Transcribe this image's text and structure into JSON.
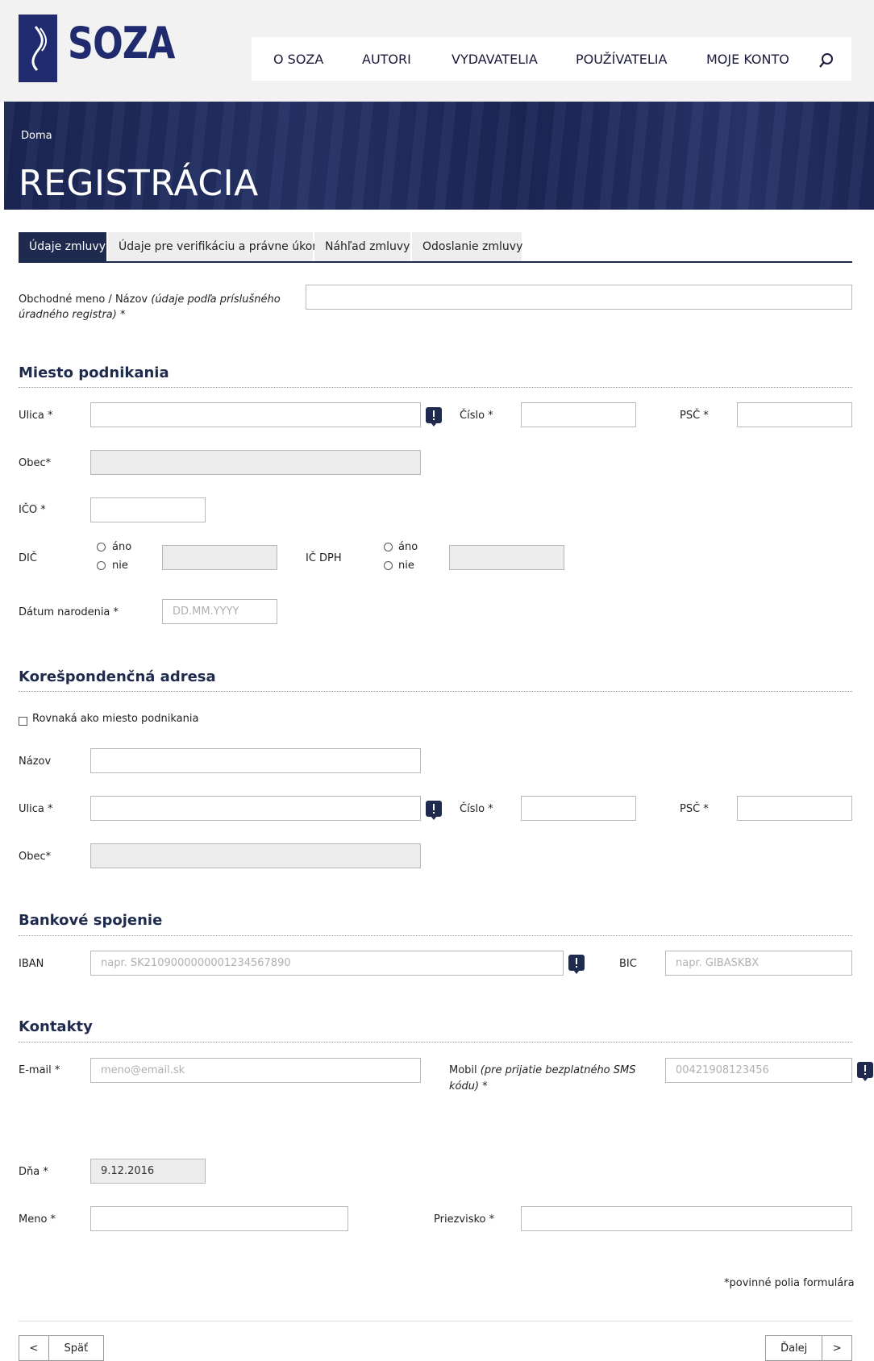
{
  "header": {
    "logo_text": "SOZA",
    "nav": [
      "O SOZA",
      "AUTORI",
      "VYDAVATELIA",
      "POUŽÍVATELIA",
      "MOJE KONTO"
    ],
    "search_icon": "search-icon"
  },
  "banner": {
    "breadcrumb": "Doma",
    "title": "REGISTRÁCIA"
  },
  "tabs": [
    "Údaje zmluvy",
    "Údaje pre verifikáciu a právne úkony",
    "Náhľad zmluvy",
    "Odoslanie zmluvy"
  ],
  "form": {
    "company_label": "Obchodné meno / Názov ",
    "company_label_italic_1": "(údaje podľa príslušného",
    "company_label_italic_2": "úradného registra)",
    "company_label_star": " *",
    "business": {
      "title": "Miesto podnikania",
      "street_label": "Ulica *",
      "number_label": "Číslo *",
      "zip_label": "PSČ *",
      "city_label": "Obec*",
      "ico_label": "IČO *",
      "dic_label": "DIČ",
      "icdph_label": "IČ DPH",
      "yes": "áno",
      "no": "nie",
      "birth_label": "Dátum narodenia *",
      "birth_placeholder": "DD.MM.YYYY"
    },
    "correspondence": {
      "title": "Korešpondenčná adresa",
      "same_as_label": "Rovnaká ako miesto podnikania",
      "name_label": "Názov",
      "street_label": "Ulica *",
      "number_label": "Číslo *",
      "zip_label": "PSČ *",
      "city_label": "Obec*"
    },
    "bank": {
      "title": "Bankové spojenie",
      "iban_label": "IBAN",
      "iban_placeholder": "napr. SK2109000000001234567890",
      "bic_label": "BIC",
      "bic_placeholder": "napr. GIBASKBX"
    },
    "contacts": {
      "title": "Kontakty",
      "email_label": "E-mail *",
      "email_placeholder": "meno@email.sk",
      "mobile_label": "Mobil ",
      "mobile_italic_1": "(pre prijatie bezplatného SMS",
      "mobile_italic_2": "kódu)",
      "mobile_star": " *",
      "mobile_placeholder": "00421908123456"
    },
    "signature": {
      "date_label": "Dňa *",
      "date_value": "9.12.2016",
      "first_name_label": "Meno *",
      "last_name_label": "Priezvisko *"
    },
    "required_note": "*povinné polia formulára"
  },
  "footer": {
    "back_label": "Späť",
    "next_label": "Ďalej",
    "back_arrow": "<",
    "next_arrow": ">"
  },
  "colors": {
    "brand_navy": "#1f2b6e",
    "tab_active": "#1f2b4e"
  }
}
